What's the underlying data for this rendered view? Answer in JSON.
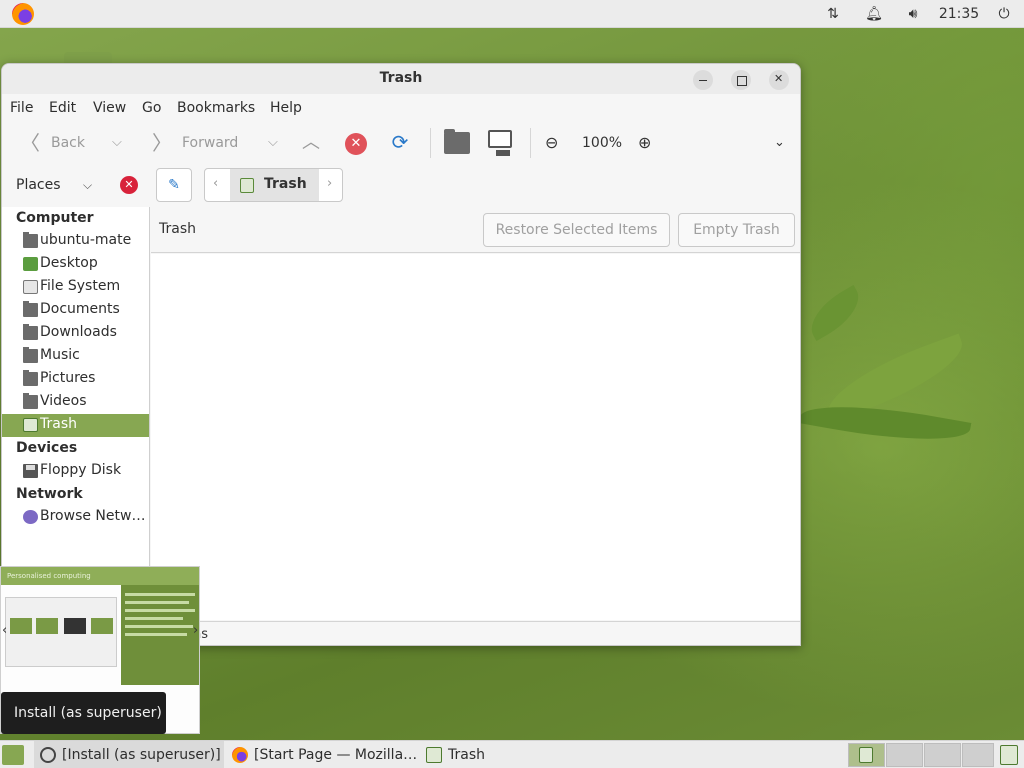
{
  "top_panel": {
    "clock": "21:35",
    "icons": [
      "firefox-icon",
      "network-icon",
      "notification-bell-icon",
      "volume-icon",
      "power-icon"
    ]
  },
  "window": {
    "title": "Trash",
    "controls": [
      "minimize",
      "maximize",
      "close"
    ]
  },
  "menubar": [
    "File",
    "Edit",
    "View",
    "Go",
    "Bookmarks",
    "Help"
  ],
  "toolbar": {
    "back": "Back",
    "forward": "Forward",
    "zoom": "100%"
  },
  "location": {
    "places_label": "Places",
    "crumb": "Trash"
  },
  "sidebar": {
    "sections": [
      {
        "title": "Computer",
        "items": [
          {
            "label": "ubuntu-mate",
            "icon": "folder-icon"
          },
          {
            "label": "Desktop",
            "icon": "desktop-icon"
          },
          {
            "label": "File System",
            "icon": "filesystem-icon"
          },
          {
            "label": "Documents",
            "icon": "folder-icon"
          },
          {
            "label": "Downloads",
            "icon": "folder-icon"
          },
          {
            "label": "Music",
            "icon": "folder-icon"
          },
          {
            "label": "Pictures",
            "icon": "folder-icon"
          },
          {
            "label": "Videos",
            "icon": "folder-icon"
          },
          {
            "label": "Trash",
            "icon": "trash-icon",
            "selected": true
          }
        ]
      },
      {
        "title": "Devices",
        "items": [
          {
            "label": "Floppy Disk",
            "icon": "floppy-icon"
          }
        ]
      },
      {
        "title": "Network",
        "items": [
          {
            "label": "Browse Netw…",
            "icon": "network-globe-icon"
          }
        ]
      }
    ]
  },
  "infobar": {
    "label": "Trash",
    "restore_button": "Restore Selected Items",
    "empty_button": "Empty Trash"
  },
  "statusbar": {
    "text": "ns"
  },
  "slideshow": {
    "heading": "Personalised computing"
  },
  "tooltip": "Install (as superuser)",
  "taskbar": {
    "tasks": [
      {
        "label": "[Install (as superuser)]",
        "active": true
      },
      {
        "label": "[Start Page — Mozilla…",
        "active": false
      },
      {
        "label": "Trash",
        "active": false
      }
    ]
  },
  "colors": {
    "accent": "#87a752",
    "stop": "#e0525a",
    "reload": "#2a79c9"
  }
}
